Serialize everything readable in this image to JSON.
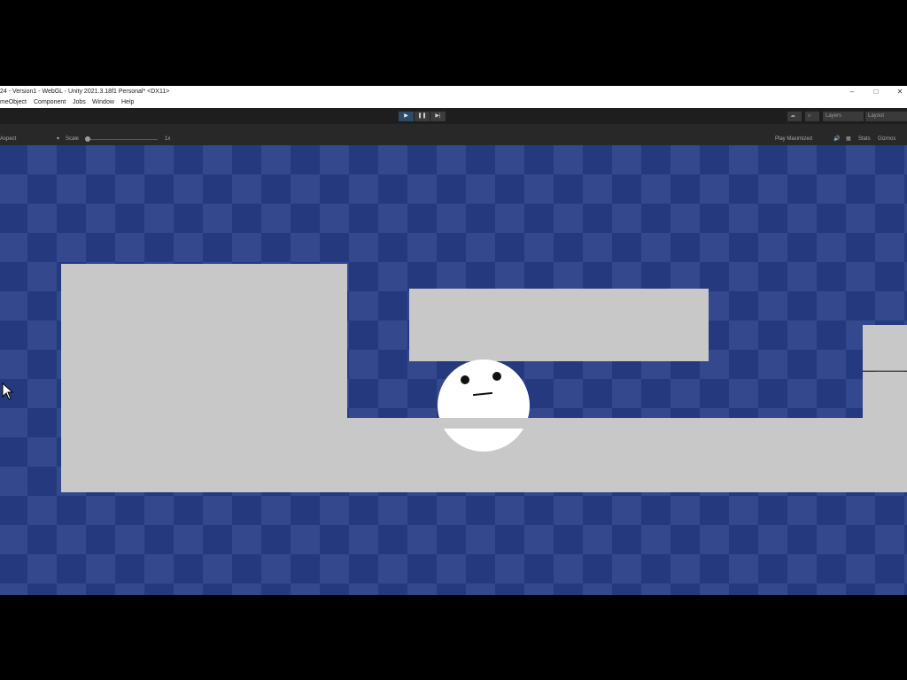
{
  "window": {
    "title": "24 - Version1 - WebGL - Unity 2021.3.18f1 Personal* <DX11>",
    "controls": {
      "minimize": "–",
      "maximize": "□",
      "close": "✕"
    }
  },
  "menu": {
    "items": [
      "meObject",
      "Component",
      "Jobs",
      "Window",
      "Help"
    ]
  },
  "toolbar": {
    "play_icon": "▶",
    "pause_icon": "❚❚",
    "step_icon": "▶|",
    "layers_label": "Layers",
    "layout_label": "Layout"
  },
  "game_view": {
    "aspect_label": "Aspect",
    "scale_label": "Scale",
    "scale_value": "1x",
    "play_mode_label": "Play Maximized",
    "stats_label": "Stats",
    "gizmos_label": "Gizmos"
  },
  "colors": {
    "scene_dark": "#25397f",
    "scene_light": "#34498d",
    "block": "#c8c8c8",
    "player": "#ffffff",
    "play_active": "#2f4b66"
  }
}
